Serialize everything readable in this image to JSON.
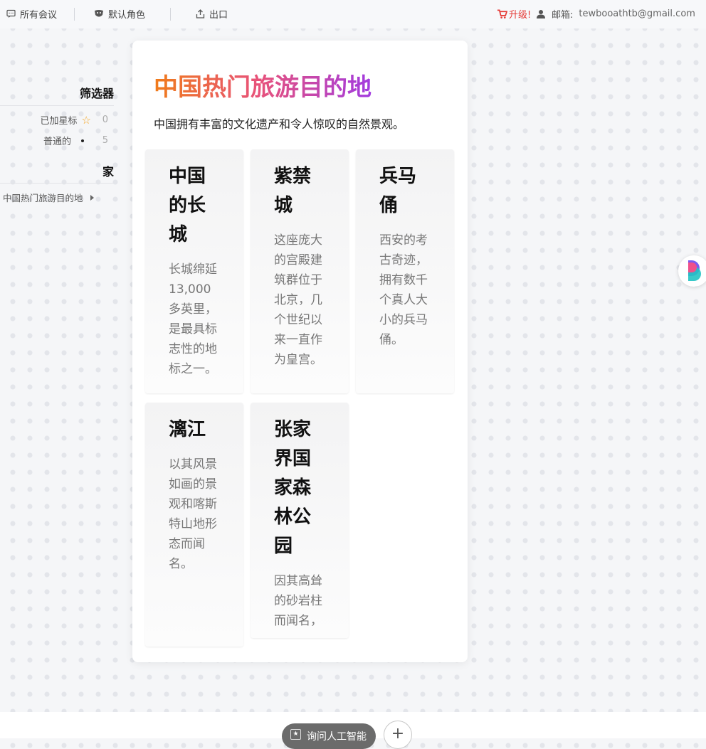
{
  "topbar": {
    "meetings": "所有会议",
    "role": "默认角色",
    "export": "出口",
    "upgrade": "升级!",
    "email_label": "邮箱:",
    "email": "tewbooathtb@gmail.com"
  },
  "sidebar": {
    "filters_title": "筛选器",
    "starred_label": "已加星标",
    "starred_count": "0",
    "normal_label": "普通的",
    "normal_count": "5",
    "home_title": "家",
    "page_link": "中国热门旅游目的地"
  },
  "main": {
    "title": "中国热门旅游目的地",
    "subtitle": "中国拥有丰富的文化遗产和令人惊叹的自然景观。",
    "destinations": [
      {
        "name": "中国的长城",
        "desc": "长城绵延13,000多英里，是最具标志性的地标之一。"
      },
      {
        "name": "紫禁城",
        "desc": "这座庞大的宫殿建筑群位于北京，几个世纪以来一直作为皇宫。"
      },
      {
        "name": "兵马俑",
        "desc": "西安的考古奇迹，拥有数千个真人大小的兵马俑。"
      },
      {
        "name": "漓江",
        "desc": "以其风景如画的景观和喀斯特山地形态而闻名。"
      },
      {
        "name": "张家界国家森林公园",
        "desc": "因其高耸的砂岩柱而闻名，"
      }
    ]
  },
  "bottom": {
    "ask_ai": "询问人工智能",
    "plus": "+"
  },
  "colors": {
    "title_gradient_start": "#f07c1a",
    "title_gradient_end": "#a23be0",
    "upgrade": "#e53935",
    "star": "#f5a623"
  }
}
